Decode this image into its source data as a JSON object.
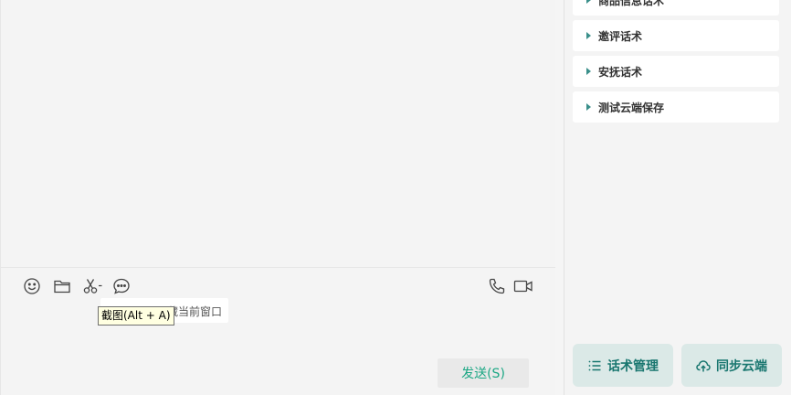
{
  "toolbar": {
    "icons": [
      "emoji-icon",
      "folder-icon",
      "scissors-icon",
      "chat-history-icon"
    ],
    "right_icons": [
      "phone-icon",
      "video-icon"
    ]
  },
  "tooltip": {
    "screenshot": "截图(Alt + A)",
    "hide_window": "藏当前窗口"
  },
  "send": {
    "label": "发送(S)"
  },
  "phrases": {
    "items": [
      {
        "label": "商品信息话术"
      },
      {
        "label": "邀评话术"
      },
      {
        "label": "安抚话术"
      },
      {
        "label": "测试云端保存"
      }
    ]
  },
  "buttons": {
    "manage": "话术管理",
    "sync": "同步云端"
  },
  "colors": {
    "accent": "#1ba784",
    "button_bg": "#dbe9e7",
    "button_text": "#18766f"
  }
}
